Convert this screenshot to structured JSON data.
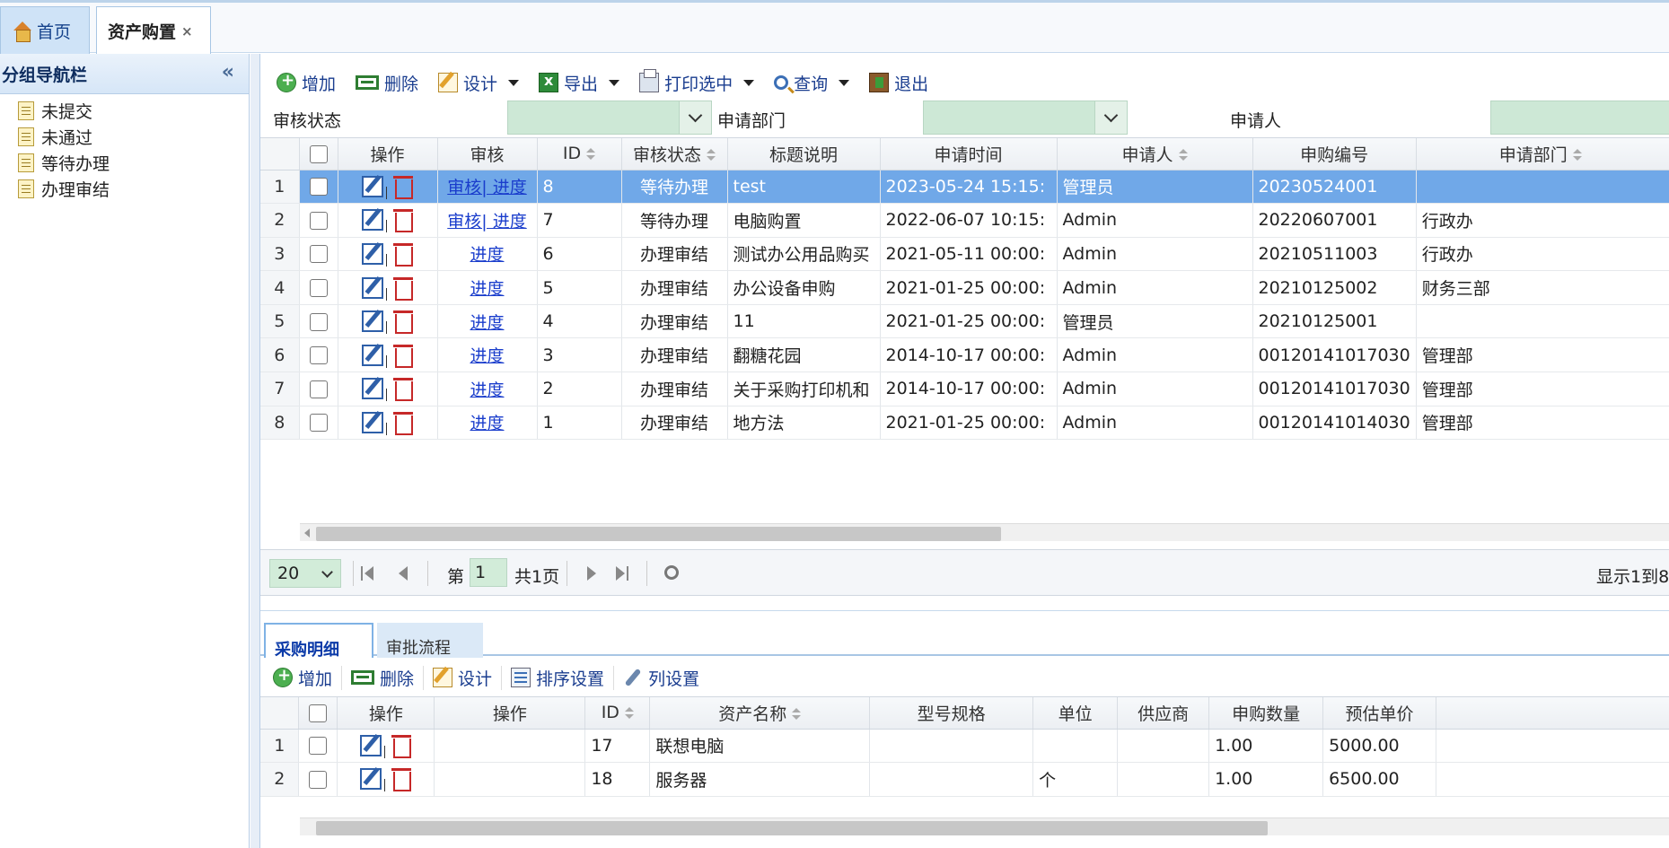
{
  "tabs": {
    "home": "首页",
    "asset": "资产购置",
    "close": "×"
  },
  "sidebar": {
    "title": "分组导航栏",
    "collapse": "«",
    "items": [
      "未提交",
      "未通过",
      "等待办理",
      "办理审结"
    ]
  },
  "toolbar": {
    "add": "增加",
    "del": "删除",
    "design": "设计",
    "export": "导出",
    "print": "打印选中",
    "search": "查询",
    "exit": "退出"
  },
  "filters": {
    "status": "审核状态",
    "dept": "申请部门",
    "person": "申请人"
  },
  "grid": {
    "headers": [
      "操作",
      "审核",
      "ID",
      "审核状态",
      "标题说明",
      "申请时间",
      "申请人",
      "申购编号",
      "申请部门"
    ],
    "rows": [
      {
        "n": "1",
        "audit": "审核| 进度",
        "id": "8",
        "status": "等待办理",
        "title": "test",
        "time": "2023-05-24 15:15:",
        "person": "管理员",
        "code": "20230524001",
        "dept": ""
      },
      {
        "n": "2",
        "audit": "审核| 进度",
        "id": "7",
        "status": "等待办理",
        "title": "电脑购置",
        "time": "2022-06-07 10:15:",
        "person": "Admin",
        "code": "20220607001",
        "dept": "行政办"
      },
      {
        "n": "3",
        "audit": "进度",
        "id": "6",
        "status": "办理审结",
        "title": "测试办公用品购买",
        "time": "2021-05-11 00:00:",
        "person": "Admin",
        "code": "20210511003",
        "dept": "行政办"
      },
      {
        "n": "4",
        "audit": "进度",
        "id": "5",
        "status": "办理审结",
        "title": "办公设备申购",
        "time": "2021-01-25 00:00:",
        "person": "Admin",
        "code": "20210125002",
        "dept": "财务三部"
      },
      {
        "n": "5",
        "audit": "进度",
        "id": "4",
        "status": "办理审结",
        "title": "11",
        "time": "2021-01-25 00:00:",
        "person": "管理员",
        "code": "20210125001",
        "dept": ""
      },
      {
        "n": "6",
        "audit": "进度",
        "id": "3",
        "status": "办理审结",
        "title": "翻糖花园",
        "time": "2014-10-17 00:00:",
        "person": "Admin",
        "code": "00120141017030",
        "dept": "管理部"
      },
      {
        "n": "7",
        "audit": "进度",
        "id": "2",
        "status": "办理审结",
        "title": "关于采购打印机和",
        "time": "2014-10-17 00:00:",
        "person": "Admin",
        "code": "00120141017030",
        "dept": "管理部"
      },
      {
        "n": "8",
        "audit": "进度",
        "id": "1",
        "status": "办理审结",
        "title": "地方法",
        "time": "2021-01-25 00:00:",
        "person": "Admin",
        "code": "00120141014030",
        "dept": "管理部"
      }
    ]
  },
  "pager": {
    "size": "20",
    "page_prefix": "第",
    "page": "1",
    "total": "共1页",
    "info": "显示1到8,"
  },
  "sub": {
    "tab_detail": "采购明细",
    "tab_flow": "审批流程",
    "toolbar": {
      "add": "增加",
      "del": "删除",
      "design": "设计",
      "sort": "排序设置",
      "cols": "列设置"
    },
    "headers": [
      "操作",
      "操作",
      "ID",
      "资产名称",
      "型号规格",
      "单位",
      "供应商",
      "申购数量",
      "预估单价"
    ],
    "rows": [
      {
        "n": "1",
        "id": "17",
        "name": "联想电脑",
        "spec": "",
        "unit": "",
        "supplier": "",
        "qty": "1.00",
        "price": "5000.00"
      },
      {
        "n": "2",
        "id": "18",
        "name": "服务器",
        "spec": "",
        "unit": "个",
        "supplier": "",
        "qty": "1.00",
        "price": "6500.00"
      }
    ]
  }
}
